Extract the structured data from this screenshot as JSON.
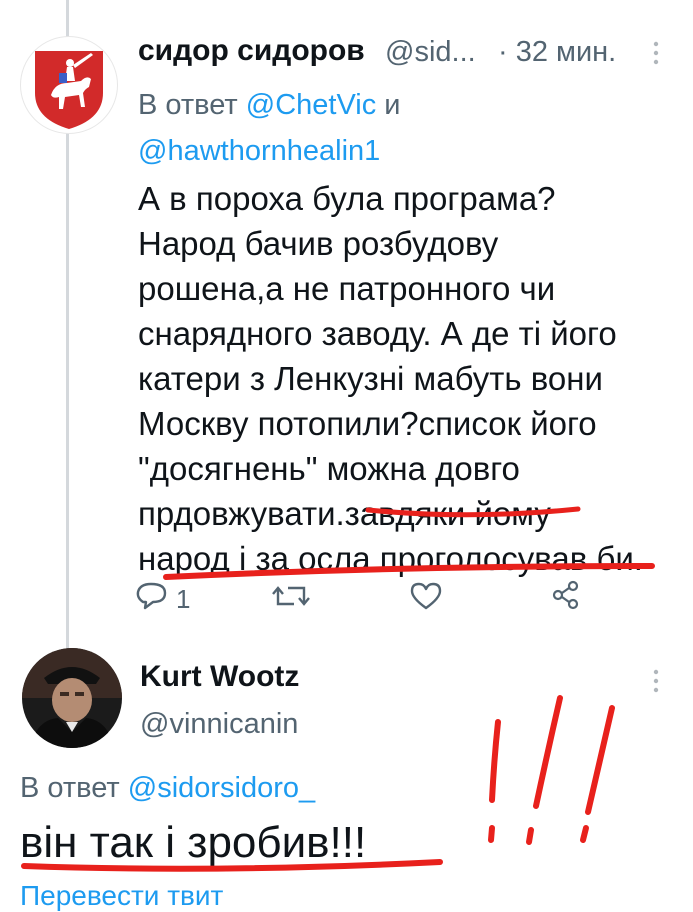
{
  "tweet1": {
    "author_name": "сидор сидоров",
    "author_handle": "@sid...",
    "time": "· 32 мин.",
    "reply_prefix": "В ответ",
    "reply_to_1": "@ChetVic",
    "reply_and": "и",
    "reply_to_2": "@hawthornhealin1",
    "body_lines": [
      "А в пороха була програма?",
      "Народ бачив розбудову",
      "рошена,а не патронного чи",
      "снарядного заводу. А де ті його",
      "катери з Ленкузні  мабуть вони",
      "Москву потопили?список його",
      "\"досягнень\" можна довго",
      "прдовжувати.завдяки йому",
      "народ і за осла проголосував би."
    ],
    "reply_count": "1"
  },
  "tweet2": {
    "author_name": "Kurt Wootz",
    "author_handle": "@vinnicanin",
    "reply_prefix": "В ответ",
    "reply_to": "@sidorsidoro_",
    "body": "він так і зробив!!!",
    "translate_link": "Перевести твит"
  },
  "colors": {
    "link": "#1d9bf0",
    "secondary_text": "#536471",
    "annotation_red": "#e8211c",
    "thread_line": "#d4d8dc"
  },
  "icons": [
    "reply-icon",
    "retweet-icon",
    "like-icon",
    "share-icon",
    "more-icon",
    "coat-of-arms-avatar",
    "profile-avatar"
  ]
}
